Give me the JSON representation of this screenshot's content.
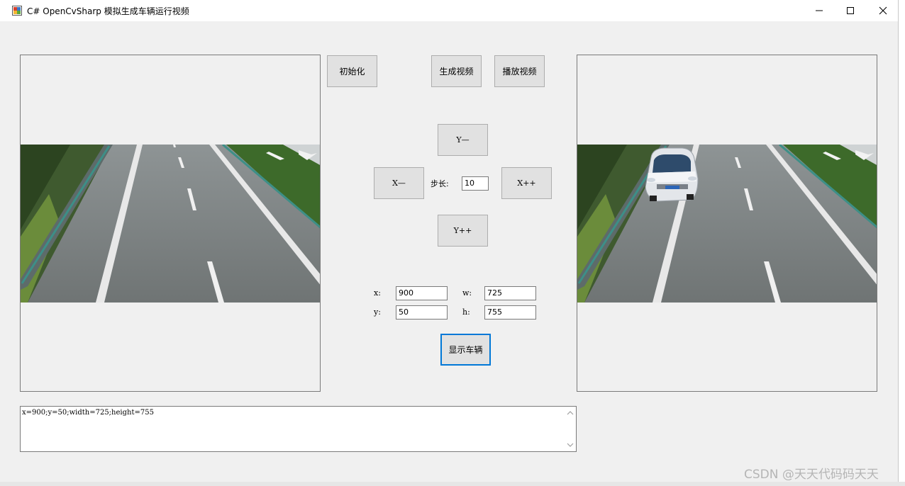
{
  "window": {
    "title": "C# OpenCvSharp 模拟生成车辆运行视频"
  },
  "buttons": {
    "init": "初始化",
    "generate": "生成视频",
    "play": "播放视频",
    "y_minus": "Y—",
    "x_minus": "X—",
    "x_plus": "X++",
    "y_plus": "Y++",
    "show_vehicle": "显示车辆"
  },
  "step": {
    "label": "步长:",
    "value": "10"
  },
  "fields": {
    "x_label": "x:",
    "x_value": "900",
    "y_label": "y:",
    "y_value": "50",
    "w_label": "w:",
    "w_value": "725",
    "h_label": "h:",
    "h_value": "755"
  },
  "log": {
    "text": "x=900;y=50;width=725;height=755"
  },
  "watermark": "CSDN @天天代码码天天",
  "colors": {
    "focus_border": "#0078d7",
    "button_bg": "#e1e1e1",
    "window_bg": "#f0f0f0"
  },
  "icons": {
    "app": "app-icon",
    "minimize": "minimize-icon",
    "maximize": "maximize-icon",
    "close": "close-icon"
  }
}
